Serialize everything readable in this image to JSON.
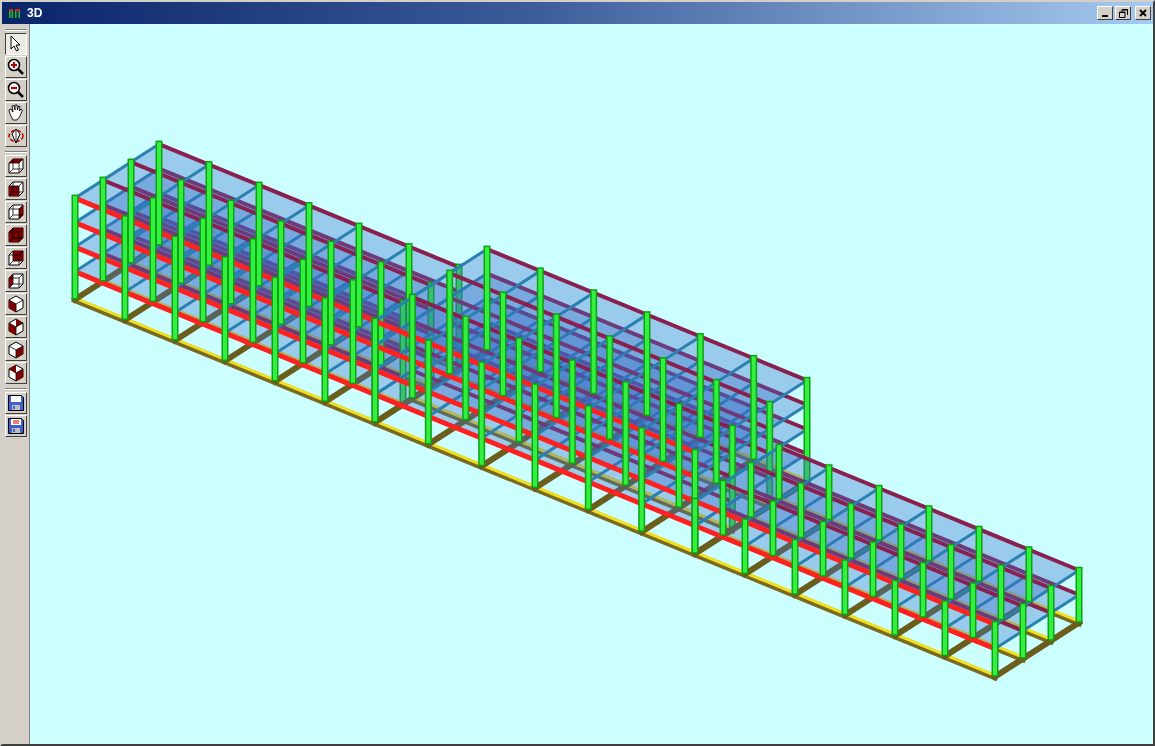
{
  "window": {
    "title": "3D"
  },
  "toolbar": {
    "groups": [
      {
        "items": [
          {
            "kind": "pointer",
            "selected": true
          },
          {
            "kind": "zoom-in",
            "selected": false
          },
          {
            "kind": "zoom-out",
            "selected": false
          },
          {
            "kind": "pan",
            "selected": false
          },
          {
            "kind": "rotate",
            "selected": false
          }
        ]
      },
      {
        "items": [
          {
            "kind": "view-top",
            "selected": false
          },
          {
            "kind": "view-front",
            "selected": false
          },
          {
            "kind": "view-right",
            "selected": false
          },
          {
            "kind": "view-solid",
            "selected": false
          },
          {
            "kind": "view-back",
            "selected": false
          },
          {
            "kind": "view-left",
            "selected": false
          },
          {
            "kind": "view-iso-left",
            "selected": false
          },
          {
            "kind": "view-iso-split",
            "selected": false
          },
          {
            "kind": "view-iso-right",
            "selected": false
          },
          {
            "kind": "view-iso-front",
            "selected": false
          }
        ]
      },
      {
        "items": [
          {
            "kind": "save",
            "selected": false
          },
          {
            "kind": "save-as",
            "selected": false
          }
        ]
      }
    ]
  }
}
